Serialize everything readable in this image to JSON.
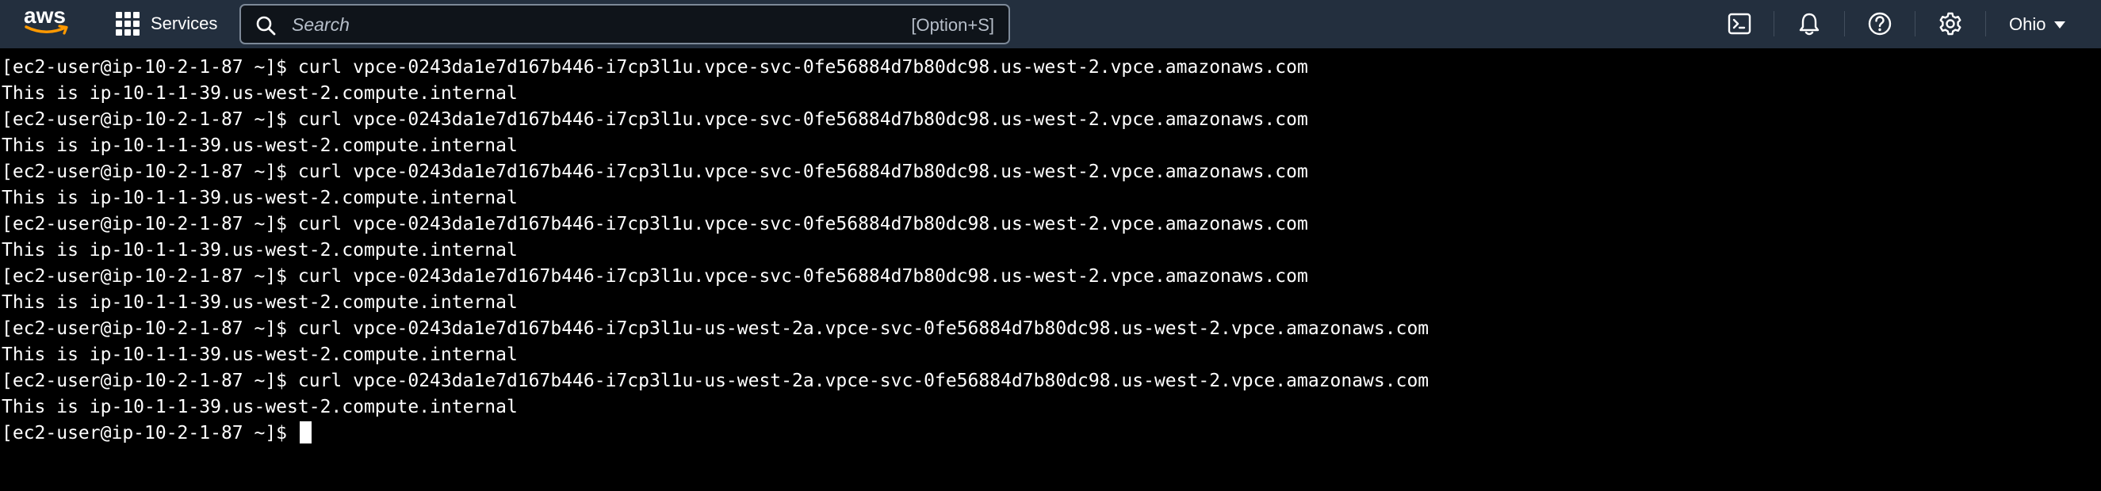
{
  "header": {
    "logo_text": "aws",
    "services_label": "Services",
    "search": {
      "placeholder": "Search",
      "shortcut": "[Option+S]"
    },
    "icons": [
      "cloudshell-icon",
      "bell-icon",
      "help-icon",
      "gear-icon"
    ],
    "region_label": "Ohio"
  },
  "terminal": {
    "lines": [
      "[ec2-user@ip-10-2-1-87 ~]$ curl vpce-0243da1e7d167b446-i7cp3l1u.vpce-svc-0fe56884d7b80dc98.us-west-2.vpce.amazonaws.com",
      "This is ip-10-1-1-39.us-west-2.compute.internal",
      "[ec2-user@ip-10-2-1-87 ~]$ curl vpce-0243da1e7d167b446-i7cp3l1u.vpce-svc-0fe56884d7b80dc98.us-west-2.vpce.amazonaws.com",
      "This is ip-10-1-1-39.us-west-2.compute.internal",
      "[ec2-user@ip-10-2-1-87 ~]$ curl vpce-0243da1e7d167b446-i7cp3l1u.vpce-svc-0fe56884d7b80dc98.us-west-2.vpce.amazonaws.com",
      "This is ip-10-1-1-39.us-west-2.compute.internal",
      "[ec2-user@ip-10-2-1-87 ~]$ curl vpce-0243da1e7d167b446-i7cp3l1u.vpce-svc-0fe56884d7b80dc98.us-west-2.vpce.amazonaws.com",
      "This is ip-10-1-1-39.us-west-2.compute.internal",
      "[ec2-user@ip-10-2-1-87 ~]$ curl vpce-0243da1e7d167b446-i7cp3l1u.vpce-svc-0fe56884d7b80dc98.us-west-2.vpce.amazonaws.com",
      "This is ip-10-1-1-39.us-west-2.compute.internal",
      "[ec2-user@ip-10-2-1-87 ~]$ curl vpce-0243da1e7d167b446-i7cp3l1u-us-west-2a.vpce-svc-0fe56884d7b80dc98.us-west-2.vpce.amazonaws.com",
      "This is ip-10-1-1-39.us-west-2.compute.internal",
      "[ec2-user@ip-10-2-1-87 ~]$ curl vpce-0243da1e7d167b446-i7cp3l1u-us-west-2a.vpce-svc-0fe56884d7b80dc98.us-west-2.vpce.amazonaws.com",
      "This is ip-10-1-1-39.us-west-2.compute.internal"
    ],
    "prompt": "[ec2-user@ip-10-2-1-87 ~]$ "
  },
  "colors": {
    "topbar_bg": "#232f3e",
    "terminal_bg": "#000000",
    "terminal_fg": "#ffffff",
    "search_border": "#7d8998"
  }
}
